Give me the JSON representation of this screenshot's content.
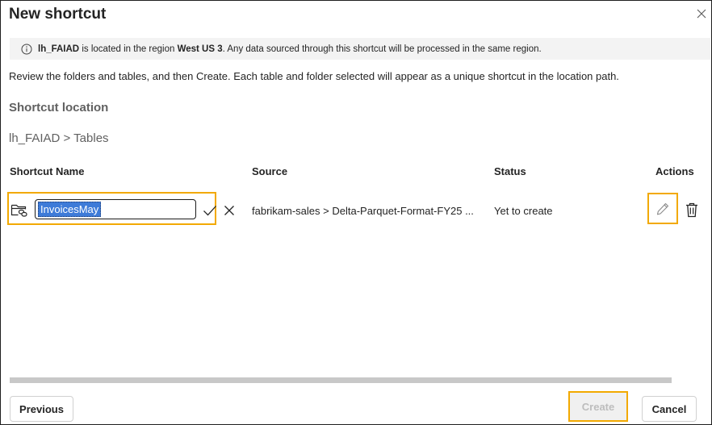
{
  "dialog": {
    "title": "New shortcut"
  },
  "info": {
    "item_name": "lh_FAIAD",
    "text_1": " is located in the region ",
    "region": "West US 3",
    "text_2": ". Any data sourced through this shortcut will be processed in the same region."
  },
  "description": "Review the folders and tables, and then Create. Each table and folder selected will appear as a unique shortcut in the location path.",
  "location": {
    "label": "Shortcut location",
    "path": "lh_FAIAD > Tables"
  },
  "table": {
    "headers": {
      "name": "Shortcut Name",
      "source": "Source",
      "status": "Status",
      "actions": "Actions"
    },
    "rows": [
      {
        "name": "InvoicesMay",
        "source": "fabrikam-sales > Delta-Parquet-Format-FY25 ...",
        "status": "Yet to create"
      }
    ]
  },
  "footer": {
    "previous_label": "Previous",
    "create_label": "Create",
    "cancel_label": "Cancel"
  },
  "icons": {
    "close": "close-icon",
    "info": "info-icon",
    "folder": "folder-link-icon",
    "confirm": "checkmark-icon",
    "discard": "dismiss-icon",
    "edit": "pencil-icon",
    "delete": "trash-icon"
  },
  "colors": {
    "highlight": "#f2a900",
    "selection": "#3e7bd8",
    "info_background": "#f3f3f3"
  }
}
